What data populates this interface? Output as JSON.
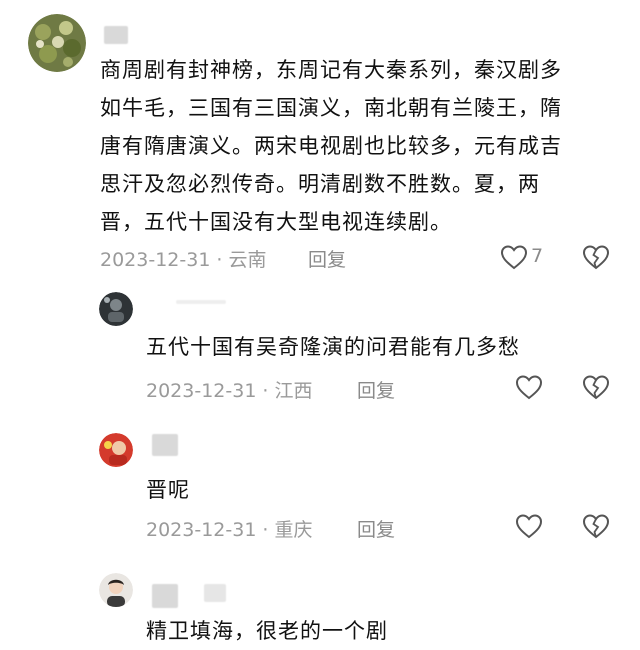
{
  "comments": [
    {
      "text_lines": [
        "商周剧有封神榜，东周记有大秦系列，秦汉剧多",
        "如牛毛，三国有三国演义，南北朝有兰陵王，隋",
        "唐有隋唐演义。两宋电视剧也比较多，元有成吉",
        "思汗及忽必烈传奇。明清剧数不胜数。夏，两",
        "晋，五代十国没有大型电视连续剧。"
      ],
      "date": "2023-12-31",
      "location": "云南",
      "reply_label": "回复",
      "like_count": "7",
      "avatar": "plant-photo"
    },
    {
      "text_lines": [
        "五代十国有吴奇隆演的问君能有几多愁"
      ],
      "date": "2023-12-31",
      "location": "江西",
      "reply_label": "回复",
      "avatar": "dark-photo"
    },
    {
      "text_lines": [
        "晋呢"
      ],
      "date": "2023-12-31",
      "location": "重庆",
      "reply_label": "回复",
      "avatar": "red-photo"
    },
    {
      "text_lines": [
        "精卫填海，很老的一个剧"
      ],
      "avatar": "person-photo"
    }
  ],
  "colors": {
    "meta_text": "#9a9a9a",
    "icon_stroke": "#555555"
  },
  "icons": {
    "like": "heart-icon",
    "dislike": "broken-heart-icon"
  }
}
